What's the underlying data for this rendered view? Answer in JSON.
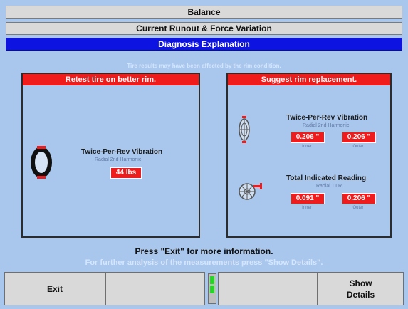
{
  "window": {
    "title": "Balance"
  },
  "screen": {
    "subtitle": "Current Runout & Force Variation",
    "header": "Diagnosis Explanation"
  },
  "info_text": "Tire results may have been affected by the rim condition.",
  "left_panel": {
    "title": "Retest tire on better rim.",
    "measurement": {
      "title": "Twice-Per-Rev Vibration",
      "subtitle": "Radial 2nd Harmonic",
      "value": "44 lbs"
    }
  },
  "right_panel": {
    "title": "Suggest rim replacement.",
    "vibration": {
      "title": "Twice-Per-Rev Vibration",
      "subtitle": "Radial 2nd Harmonic",
      "inner_value": "0.206 \"",
      "outer_value": "0.206 \"",
      "inner_label": "Inner",
      "outer_label": "Outer"
    },
    "tir": {
      "title": "Total Indicated Reading",
      "subtitle": "Radial T.I.R.",
      "inner_value": "0.091 \"",
      "outer_value": "0.206 \"",
      "inner_label": "Inner",
      "outer_label": "Outer"
    }
  },
  "hint_primary": "Press \"Exit\" for more information.",
  "hint_secondary": "For further analysis of the measurements press \"Show Details\".",
  "buttons": {
    "exit": "Exit",
    "f2": "",
    "f3": "",
    "show_details": "Show Details"
  },
  "icons": {
    "tire": "tire-icon",
    "rim": "rim-icon",
    "rim_gauge": "rim-gauge-icon"
  },
  "colors": {
    "header_blue": "#0d13e0",
    "alert_red": "#f01c1c",
    "background": "#a9c7ec",
    "indicator_green": "#26d626"
  }
}
